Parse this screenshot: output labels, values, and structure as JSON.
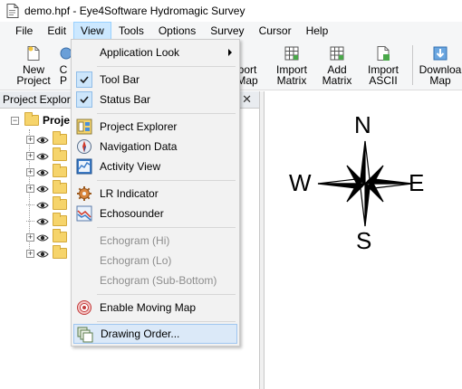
{
  "window": {
    "title": "demo.hpf - Eye4Software Hydromagic Survey"
  },
  "menubar": {
    "items": [
      {
        "label": "File"
      },
      {
        "label": "Edit"
      },
      {
        "label": "View"
      },
      {
        "label": "Tools"
      },
      {
        "label": "Options"
      },
      {
        "label": "Survey"
      },
      {
        "label": "Cursor"
      },
      {
        "label": "Help"
      }
    ]
  },
  "toolbar": {
    "new_project": {
      "line1": "New",
      "line2": "Project"
    },
    "partial": {
      "line1": "C",
      "line2": "P"
    },
    "import_map": {
      "line1": "port",
      "line2": "Map"
    },
    "import_matrix": {
      "line1": "Import",
      "line2": "Matrix"
    },
    "add_matrix": {
      "line1": "Add",
      "line2": "Matrix"
    },
    "import_ascii": {
      "line1": "Import",
      "line2": "ASCII"
    },
    "download_map": {
      "line1": "Downloa",
      "line2": "Map"
    }
  },
  "project_explorer": {
    "header": "Project Explore",
    "close_glyph": "✕",
    "root_label": "Proje",
    "expander_symbol": "⊟"
  },
  "compass": {
    "north": "N",
    "south": "S",
    "east": "E",
    "west": "W"
  },
  "view_menu": {
    "items": [
      {
        "label": "Application Look",
        "has_submenu": true
      },
      {
        "label": "Tool Bar",
        "checked": true
      },
      {
        "label": "Status Bar",
        "checked": true
      },
      {
        "label": "Project Explorer",
        "icon": "project-explorer-icon"
      },
      {
        "label": "Navigation Data",
        "icon": "compass-icon"
      },
      {
        "label": "Activity View",
        "icon": "activity-view-icon"
      },
      {
        "label": "LR Indicator",
        "icon": "gear-icon"
      },
      {
        "label": "Echosounder",
        "icon": "echosounder-icon"
      },
      {
        "label": "Echogram (Hi)",
        "disabled": true
      },
      {
        "label": "Echogram (Lo)",
        "disabled": true
      },
      {
        "label": "Echogram (Sub-Bottom)",
        "disabled": true
      },
      {
        "label": "Enable Moving Map",
        "icon": "target-icon"
      },
      {
        "label": "Drawing Order...",
        "icon": "drawing-order-icon",
        "highlighted": true
      }
    ]
  }
}
